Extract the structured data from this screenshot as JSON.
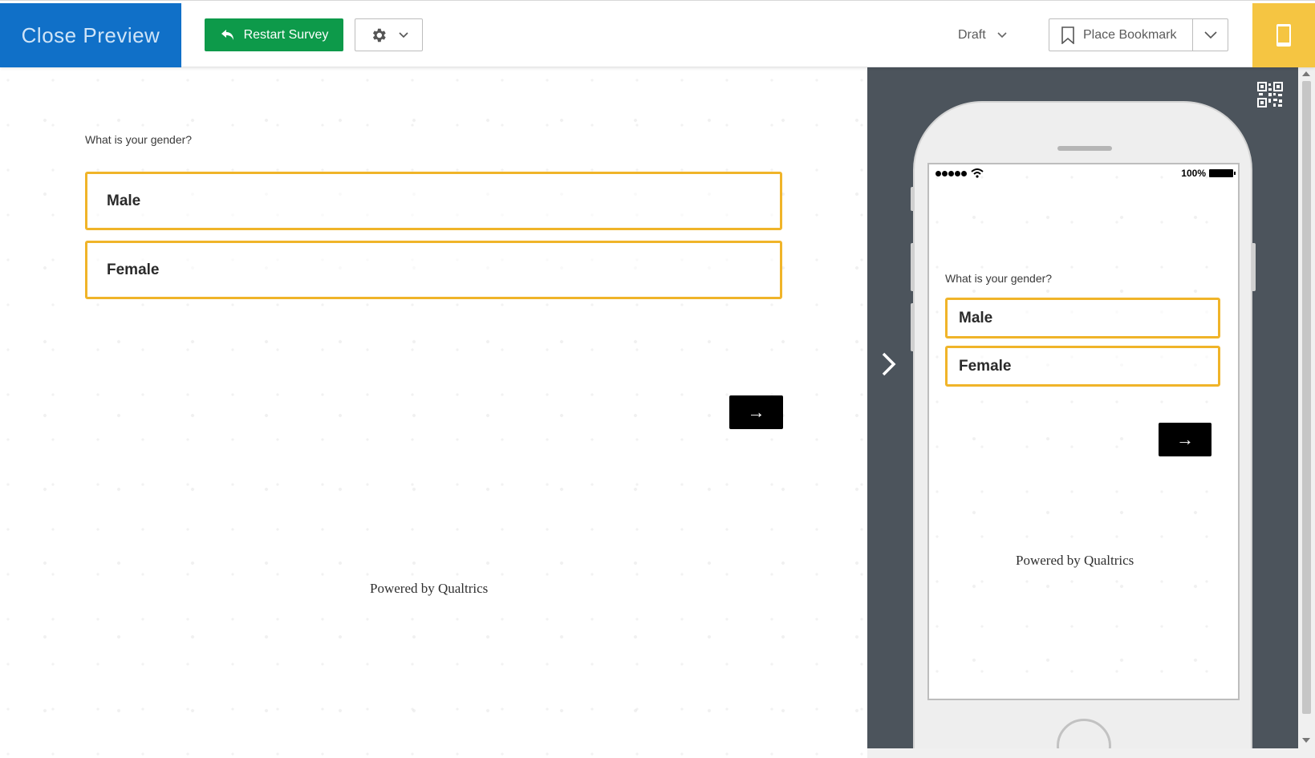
{
  "toolbar": {
    "close_preview": "Close Preview",
    "restart_survey": "Restart Survey",
    "status": "Draft",
    "place_bookmark": "Place Bookmark"
  },
  "survey": {
    "question": "What is your gender?",
    "choices": [
      "Male",
      "Female"
    ],
    "next": "→",
    "powered_by": "Powered by Qualtrics"
  },
  "mobile": {
    "battery": "100%",
    "question": "What is your gender?",
    "choices": [
      "Male",
      "Female"
    ],
    "next": "→",
    "powered_by": "Powered by Qualtrics"
  },
  "colors": {
    "close_preview_bg": "#1070c8",
    "restart_bg": "#0d9a4a",
    "choice_border": "#f0b429",
    "mobile_toggle_bg": "#f5c542",
    "preview_panel_bg": "#4c545c"
  },
  "icons": {
    "restart": "undo-arrow-icon",
    "settings": "gear-icon",
    "bookmark": "bookmark-icon",
    "mobile": "mobile-phone-icon",
    "collapse": "chevron-right-icon",
    "qr": "qr-code-icon"
  }
}
